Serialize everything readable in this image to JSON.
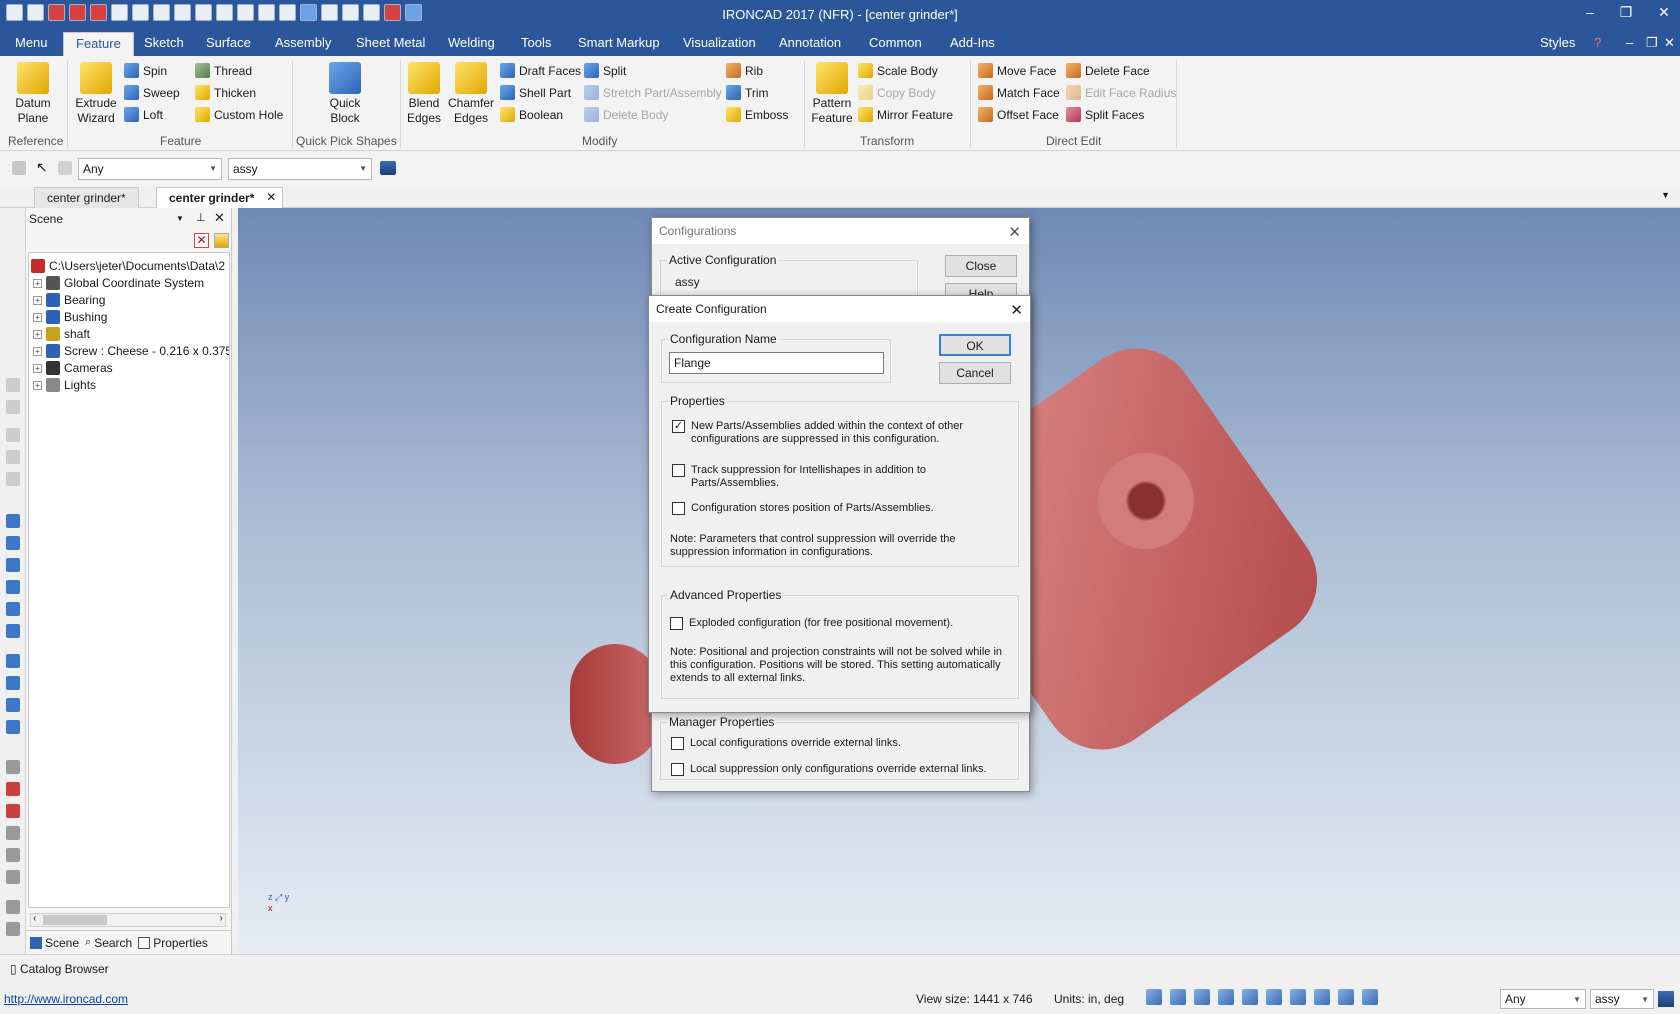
{
  "window": {
    "title": "IRONCAD 2017 (NFR) - [center grinder*]"
  },
  "menu": {
    "tabs": [
      "Menu",
      "Feature",
      "Sketch",
      "Surface",
      "Assembly",
      "Sheet Metal",
      "Welding",
      "Tools",
      "Smart Markup",
      "Visualization",
      "Annotation",
      "Common",
      "Add-Ins"
    ],
    "active": "Feature",
    "styles": "Styles"
  },
  "ribbon": {
    "reference": {
      "label": "Reference",
      "datum_plane": "Datum Plane"
    },
    "feature": {
      "label": "Feature",
      "extrude_wizard": "Extrude Wizard",
      "spin": "Spin",
      "sweep": "Sweep",
      "loft": "Loft",
      "thread": "Thread",
      "thicken": "Thicken",
      "custom_hole": "Custom Hole"
    },
    "quick_pick": {
      "label": "Quick Pick Shapes",
      "quick_block": "Quick Block"
    },
    "modify": {
      "label": "Modify",
      "blend_edges": "Blend Edges",
      "chamfer_edges": "Chamfer Edges",
      "draft_faces": "Draft Faces",
      "shell_part": "Shell Part",
      "boolean": "Boolean",
      "split": "Split",
      "stretch": "Stretch Part/Assembly",
      "delete_body": "Delete Body",
      "rib": "Rib",
      "trim": "Trim",
      "emboss": "Emboss"
    },
    "transform": {
      "label": "Transform",
      "pattern_feature": "Pattern Feature",
      "scale_body": "Scale Body",
      "copy_body": "Copy Body",
      "mirror_feature": "Mirror Feature"
    },
    "direct_edit": {
      "label": "Direct Edit",
      "move_face": "Move Face",
      "match_face": "Match Face",
      "offset_face": "Offset Face",
      "delete_face": "Delete Face",
      "edit_face_radius": "Edit Face Radius",
      "split_faces": "Split Faces"
    }
  },
  "toolbar": {
    "filter_value": "Any",
    "config_value": "assy"
  },
  "doc_tabs": [
    "center grinder*",
    "center grinder*"
  ],
  "scene": {
    "title": "Scene",
    "root": "C:\\Users\\jeter\\Documents\\Data\\2",
    "items": [
      "Global Coordinate System",
      "Bearing",
      "Bushing",
      "shaft",
      "Screw : Cheese - 0.216 x 0.375",
      "Cameras",
      "Lights"
    ],
    "bottom_tabs": [
      "Scene",
      "Search",
      "Properties"
    ]
  },
  "configurations_dialog": {
    "title": "Configurations",
    "active_label": "Active Configuration",
    "active_value": "assy",
    "close_btn": "Close",
    "help_btn": "Help",
    "manager_label": "Manager Properties",
    "local_override": "Local configurations override external links.",
    "local_suppression": "Local suppression only configurations override external links."
  },
  "create_dialog": {
    "title": "Create Configuration",
    "name_label": "Configuration Name",
    "name_value": "Flange",
    "ok": "OK",
    "cancel": "Cancel",
    "properties_label": "Properties",
    "prop1": "New Parts/Assemblies added within the context of other configurations are suppressed in this configuration.",
    "prop1_checked": true,
    "prop2": "Track suppression for Intellishapes in addition to Parts/Assemblies.",
    "prop2_checked": false,
    "prop3": "Configuration stores position of Parts/Assemblies.",
    "prop3_checked": false,
    "note1": "Note: Parameters that control suppression will override the suppression information in configurations.",
    "advanced_label": "Advanced Properties",
    "exploded": "Exploded configuration (for free positional movement).",
    "exploded_checked": false,
    "note2": "Note: Positional and projection constraints will not be solved while in this configuration. Positions will be stored.  This setting automatically extends to all external links."
  },
  "status": {
    "catalog_browser": "Catalog Browser",
    "url": "http://www.ironcad.com",
    "view_size": "View size: 1441 x  746",
    "units": "Units: in, deg",
    "filter": "Any",
    "config": "assy"
  },
  "colors": {
    "accent": "#2b579a",
    "part": "#d06b6b"
  }
}
